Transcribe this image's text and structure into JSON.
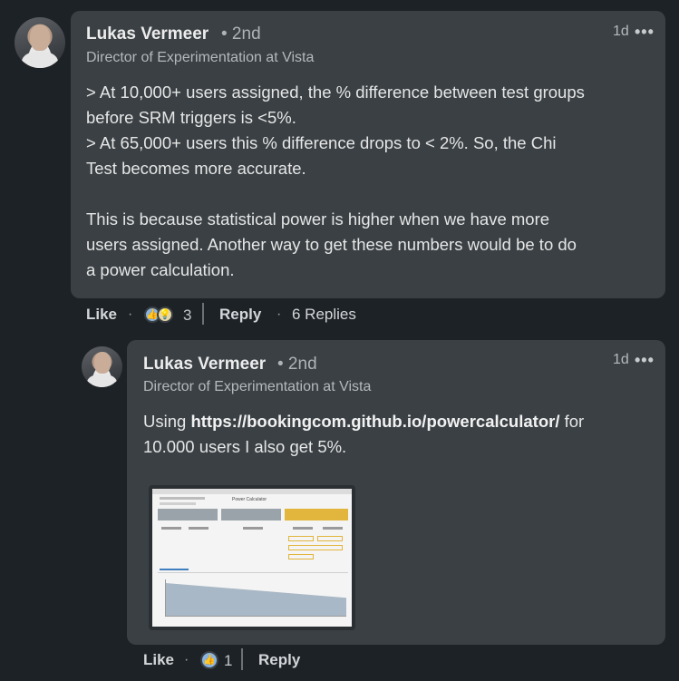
{
  "comment": {
    "author": "Lukas Vermeer",
    "degree": "• 2nd",
    "headline": "Director of Experimentation at Vista",
    "time": "1d",
    "more": "•••",
    "lines": [
      "> At 10,000+ users assigned, the % difference between test groups",
      "before SRM triggers is <5%.",
      "> At 65,000+ users this % difference drops to < 2%. So, the Chi",
      "Test becomes more accurate.",
      "This is because statistical power is higher when we have more",
      "users assigned. Another way to get these numbers would be to do",
      "a power calculation."
    ],
    "like_label": "Like",
    "reaction_count": "3",
    "reply_label": "Reply",
    "replies_label": "6 Replies"
  },
  "reply": {
    "author": "Lukas Vermeer",
    "degree": "• 2nd",
    "headline": "Director of Experimentation at Vista",
    "time": "1d",
    "more": "•••",
    "text_prefix": "Using ",
    "link": "https://bookingcom.github.io/powercalculator/",
    "text_suffix": " for",
    "line2": "10.000 users I also get 5%.",
    "like_label": "Like",
    "reaction_count": "1",
    "reply_label": "Reply",
    "attachment_title": "Power Calculator"
  },
  "colors": {
    "background": "#1d2226",
    "bubble": "#3a4044",
    "accent_yellow": "#e2b53c"
  }
}
